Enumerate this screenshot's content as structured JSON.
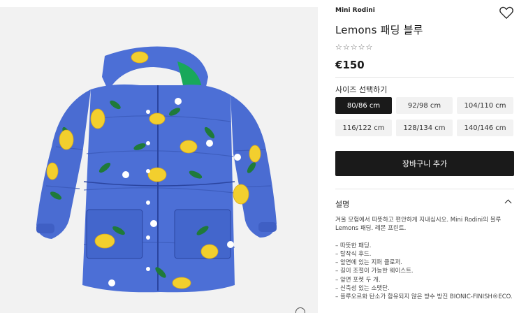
{
  "brand": "Mini Rodini",
  "product": {
    "title": "Lemons 패딩 블루",
    "rating_stars": "☆☆☆☆☆",
    "price": "€150"
  },
  "sizes": {
    "label": "사이즈 선택하기",
    "options": [
      "80/86 cm",
      "92/98 cm",
      "104/110 cm",
      "116/122 cm",
      "128/134 cm",
      "140/146 cm"
    ],
    "selected": "80/86 cm"
  },
  "cart_button": "장바구니 추가",
  "description": {
    "heading": "설명",
    "intro": "겨울 모험에서 따뜻하고 편안하게 지내십시오. Mini Rodini의 블루 Lemons 패딩. 레몬 프린트.",
    "features": [
      "– 따뜻한 패딩.",
      "– 탈착식 후드.",
      "– 앞면에 있는 지퍼 클로저.",
      "– 길이 조절이 가능한 웨이스트.",
      "– 앞면 포켓 두 개.",
      "– 신축성 있는 소맷단.",
      "– 플루오르화 탄소가 함유되지 않은 방수 방진 BIONIC-FINISH®ECO."
    ]
  },
  "icons": {
    "wishlist": "heart-icon",
    "expand": "chevron-up-icon",
    "zoom": "zoom-icon"
  },
  "colors": {
    "jacket_blue": "#4c6fd6",
    "lemon_yellow": "#f2cf2e",
    "leaf_green": "#1f7a3a",
    "button_dark": "#1a1a1a"
  }
}
